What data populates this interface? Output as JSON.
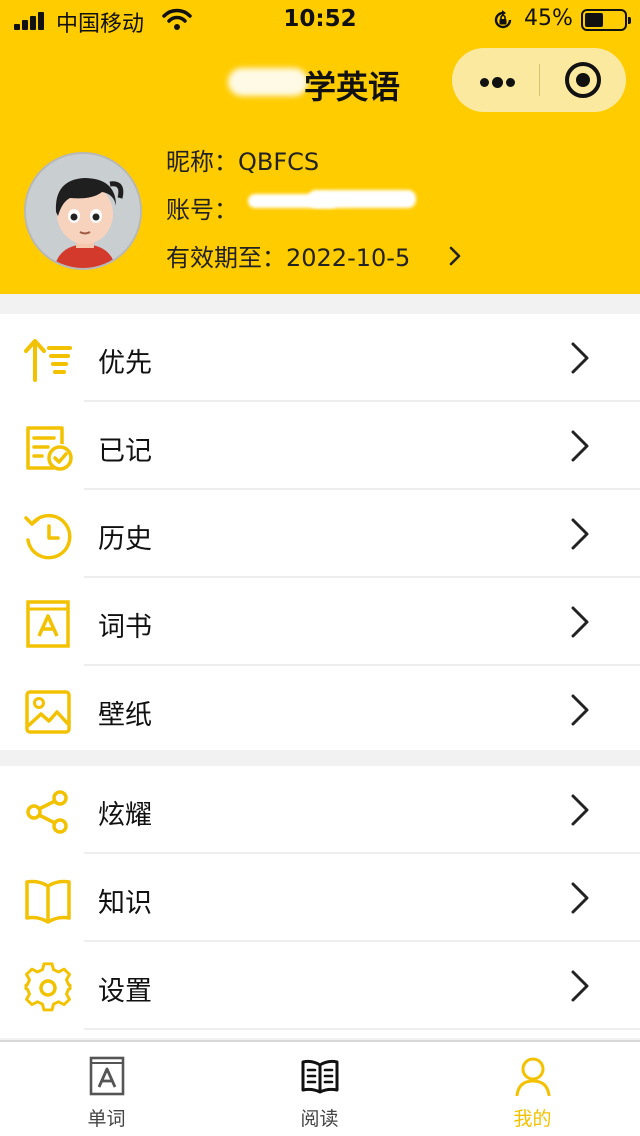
{
  "status_bar": {
    "carrier": "中国移动",
    "time": "10:52",
    "battery_percent": "45%",
    "battery_level": 0.45
  },
  "nav": {
    "title": "学英语"
  },
  "profile": {
    "nickname_label": "昵称：",
    "nickname_value": "QBFCS",
    "account_label": "账号：",
    "expiry_label": "有效期至：",
    "expiry_value": "2022-10-5"
  },
  "menu_group_1": [
    {
      "label": "优先",
      "icon": "priority-sort-icon"
    },
    {
      "label": "已记",
      "icon": "memorized-check-icon"
    },
    {
      "label": "历史",
      "icon": "history-clock-icon"
    },
    {
      "label": "词书",
      "icon": "word-book-icon"
    },
    {
      "label": "壁纸",
      "icon": "wallpaper-image-icon"
    }
  ],
  "menu_group_2": [
    {
      "label": "炫耀",
      "icon": "share-icon"
    },
    {
      "label": "知识",
      "icon": "open-book-icon"
    },
    {
      "label": "设置",
      "icon": "gear-icon"
    }
  ],
  "tabbar": [
    {
      "label": "单词",
      "icon": "word-card-icon",
      "active": false
    },
    {
      "label": "阅读",
      "icon": "reading-book-icon",
      "active": false
    },
    {
      "label": "我的",
      "icon": "user-icon",
      "active": true
    }
  ],
  "colors": {
    "brand": "#ffcc00",
    "icon": "#f2c200",
    "active_tab": "#f2c200"
  }
}
